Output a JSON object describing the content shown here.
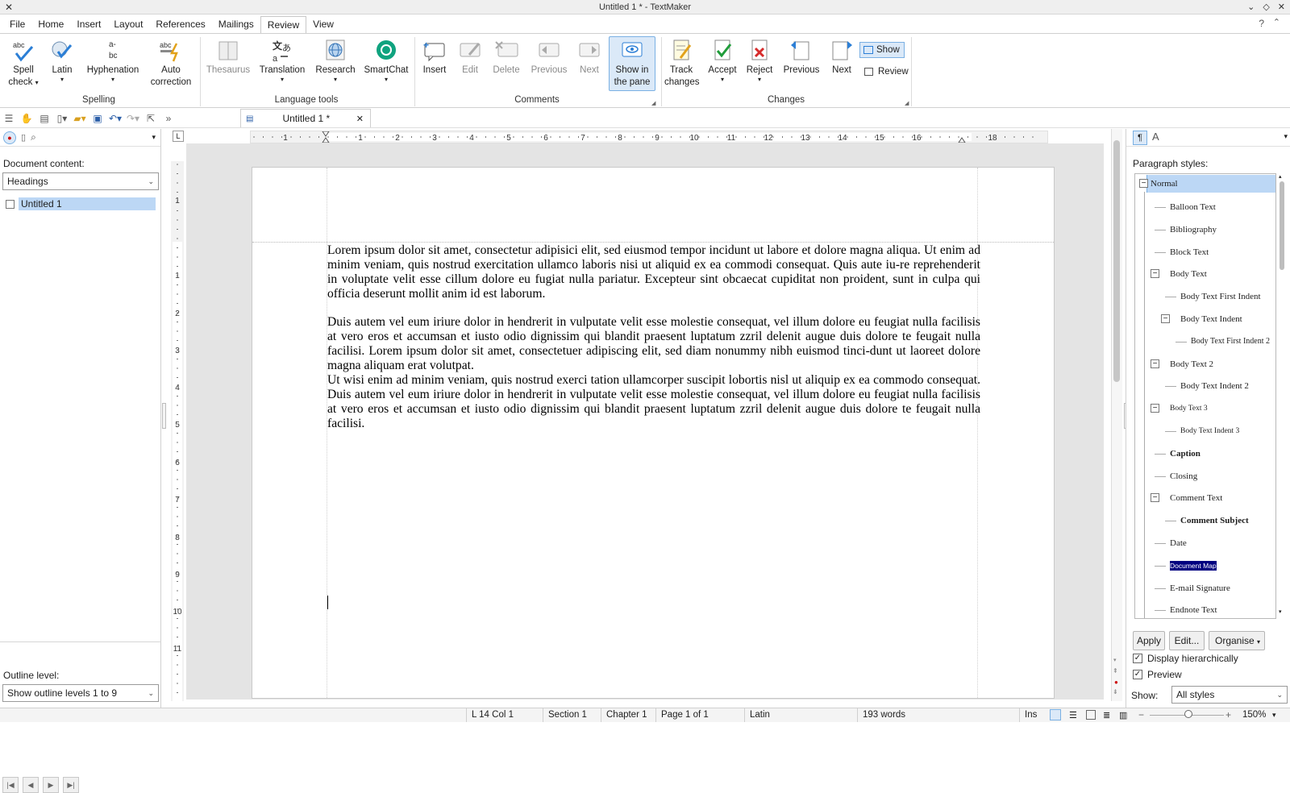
{
  "window": {
    "title": "Untitled 1 * - TextMaker"
  },
  "menu": {
    "items": [
      "File",
      "Home",
      "Insert",
      "Layout",
      "References",
      "Mailings",
      "Review",
      "View"
    ],
    "active": "Review",
    "help": "?"
  },
  "ribbon": {
    "spelling": {
      "spell_check": [
        "Spell",
        "check"
      ],
      "latin": "Latin",
      "hyphenation": "Hyphenation",
      "auto_correction": [
        "Auto",
        "correction"
      ],
      "group_label": "Spelling"
    },
    "language_tools": {
      "thesaurus": "Thesaurus",
      "translation": "Translation",
      "research": "Research",
      "smartchat": "SmartChat",
      "group_label": "Language tools"
    },
    "comments": {
      "insert": "Insert",
      "edit": "Edit",
      "delete": "Delete",
      "previous": "Previous",
      "next": "Next",
      "show_in_pane": [
        "Show in",
        "the pane"
      ],
      "group_label": "Comments"
    },
    "changes": {
      "track_changes": [
        "Track",
        "changes"
      ],
      "accept": "Accept",
      "reject": "Reject",
      "previous": "Previous",
      "next": "Next",
      "show": "Show",
      "review": "Review",
      "group_label": "Changes"
    }
  },
  "document_tab": {
    "label": "Untitled 1 *"
  },
  "left_panel": {
    "document_content_label": "Document content:",
    "content_combo": "Headings",
    "tree_item": "Untitled 1",
    "outline_level_label": "Outline level:",
    "outline_combo": "Show outline levels 1 to 9"
  },
  "ruler": {
    "h_ticks": [
      "1",
      "1",
      "2",
      "3",
      "4",
      "5",
      "6",
      "7",
      "8",
      "9",
      "10",
      "11",
      "12",
      "13",
      "14",
      "15",
      "16",
      "18"
    ],
    "v_ticks": [
      "1",
      "1",
      "2",
      "3",
      "4",
      "5",
      "6",
      "7",
      "8",
      "9",
      "10",
      "11"
    ]
  },
  "document": {
    "paragraphs": [
      "Lorem ipsum dolor sit amet, consectetur adipisici elit, sed eiusmod tempor incidunt ut labore et dolore magna aliqua. Ut enim ad minim veniam, quis nostrud exercitation ullamco laboris nisi ut aliquid ex ea commodi consequat. Quis aute iu-re reprehenderit in voluptate velit esse cillum dolore eu fugiat nulla pariatur. Excepteur sint obcaecat cupiditat non proident, sunt in culpa qui officia deserunt mollit anim id est laborum.",
      "Duis autem vel eum iriure dolor in hendrerit in vulputate velit esse molestie consequat, vel illum dolore eu feugiat nulla facilisis at vero eros et accumsan et iusto odio dignissim qui blandit praesent luptatum zzril delenit augue duis dolore te feugait nulla facilisi. Lorem ipsum dolor sit amet, consectetuer adipiscing elit, sed diam nonummy nibh euismod tinci-dunt ut laoreet dolore magna aliquam erat volutpat.",
      "Ut wisi enim ad minim veniam, quis nostrud exerci tation ullamcorper suscipit lobortis nisl ut aliquip ex ea commodo consequat. Duis autem vel eum iriure dolor in hendrerit in vulputate velit esse molestie consequat, vel illum dolore eu feugiat nulla facilisis at vero eros et accumsan et iusto odio dignissim qui blandit praesent luptatum zzril delenit augue duis dolore te feugait nulla facilisi."
    ]
  },
  "right_panel": {
    "paragraph_styles_label": "Paragraph styles:",
    "styles": [
      "Normal",
      "Balloon Text",
      "Bibliography",
      "Block Text",
      "Body Text",
      "Body Text First Indent",
      "Body Text Indent",
      "Body Text First Indent 2",
      "Body Text 2",
      "Body Text Indent 2",
      "Body Text 3",
      "Body Text Indent 3",
      "Caption",
      "Closing",
      "Comment Text",
      "Comment Subject",
      "Date",
      "Document Map",
      "E-mail Signature",
      "Endnote Text"
    ],
    "apply": "Apply",
    "edit": "Edit...",
    "organise": "Organise",
    "display_hierarchically": "Display hierarchically",
    "preview": "Preview",
    "show_label": "Show:",
    "show_combo": "All styles"
  },
  "status": {
    "position": "L 14 Col 1",
    "section": "Section 1",
    "chapter": "Chapter 1",
    "page": "Page 1 of 1",
    "language": "Latin",
    "words": "193 words",
    "mode": "Ins",
    "zoom": "150%"
  },
  "colors": {
    "accent": "#2c7fd6",
    "selection": "#bcd7f5",
    "doc_map_highlight": "#000080"
  }
}
